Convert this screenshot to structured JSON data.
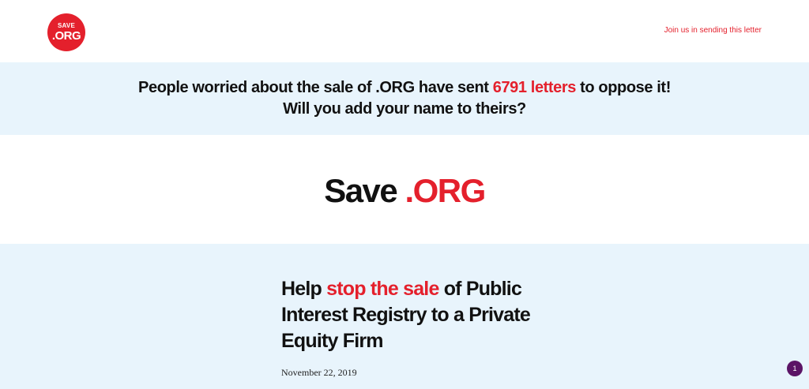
{
  "header": {
    "logo": {
      "top": "SAVE",
      "bottom": ".ORG"
    },
    "join_link": "Join us in sending this letter"
  },
  "banner": {
    "line1_prefix": "People worried about the sale of .ORG have sent ",
    "letters_count": "6791 letters",
    "line1_suffix": " to oppose it!",
    "line2": "Will you add your name to theirs?"
  },
  "hero": {
    "title_prefix": "Save ",
    "title_accent": ".ORG"
  },
  "article": {
    "title_prefix": "Help ",
    "title_accent": "stop the sale",
    "title_suffix": " of Public Interest Registry to a Private Equity Firm",
    "date": "November 22, 2019"
  },
  "notification_badge": "1",
  "colors": {
    "accent": "#e4202c",
    "banner_bg": "#e8f4fc",
    "badge_bg": "#5b1466"
  }
}
